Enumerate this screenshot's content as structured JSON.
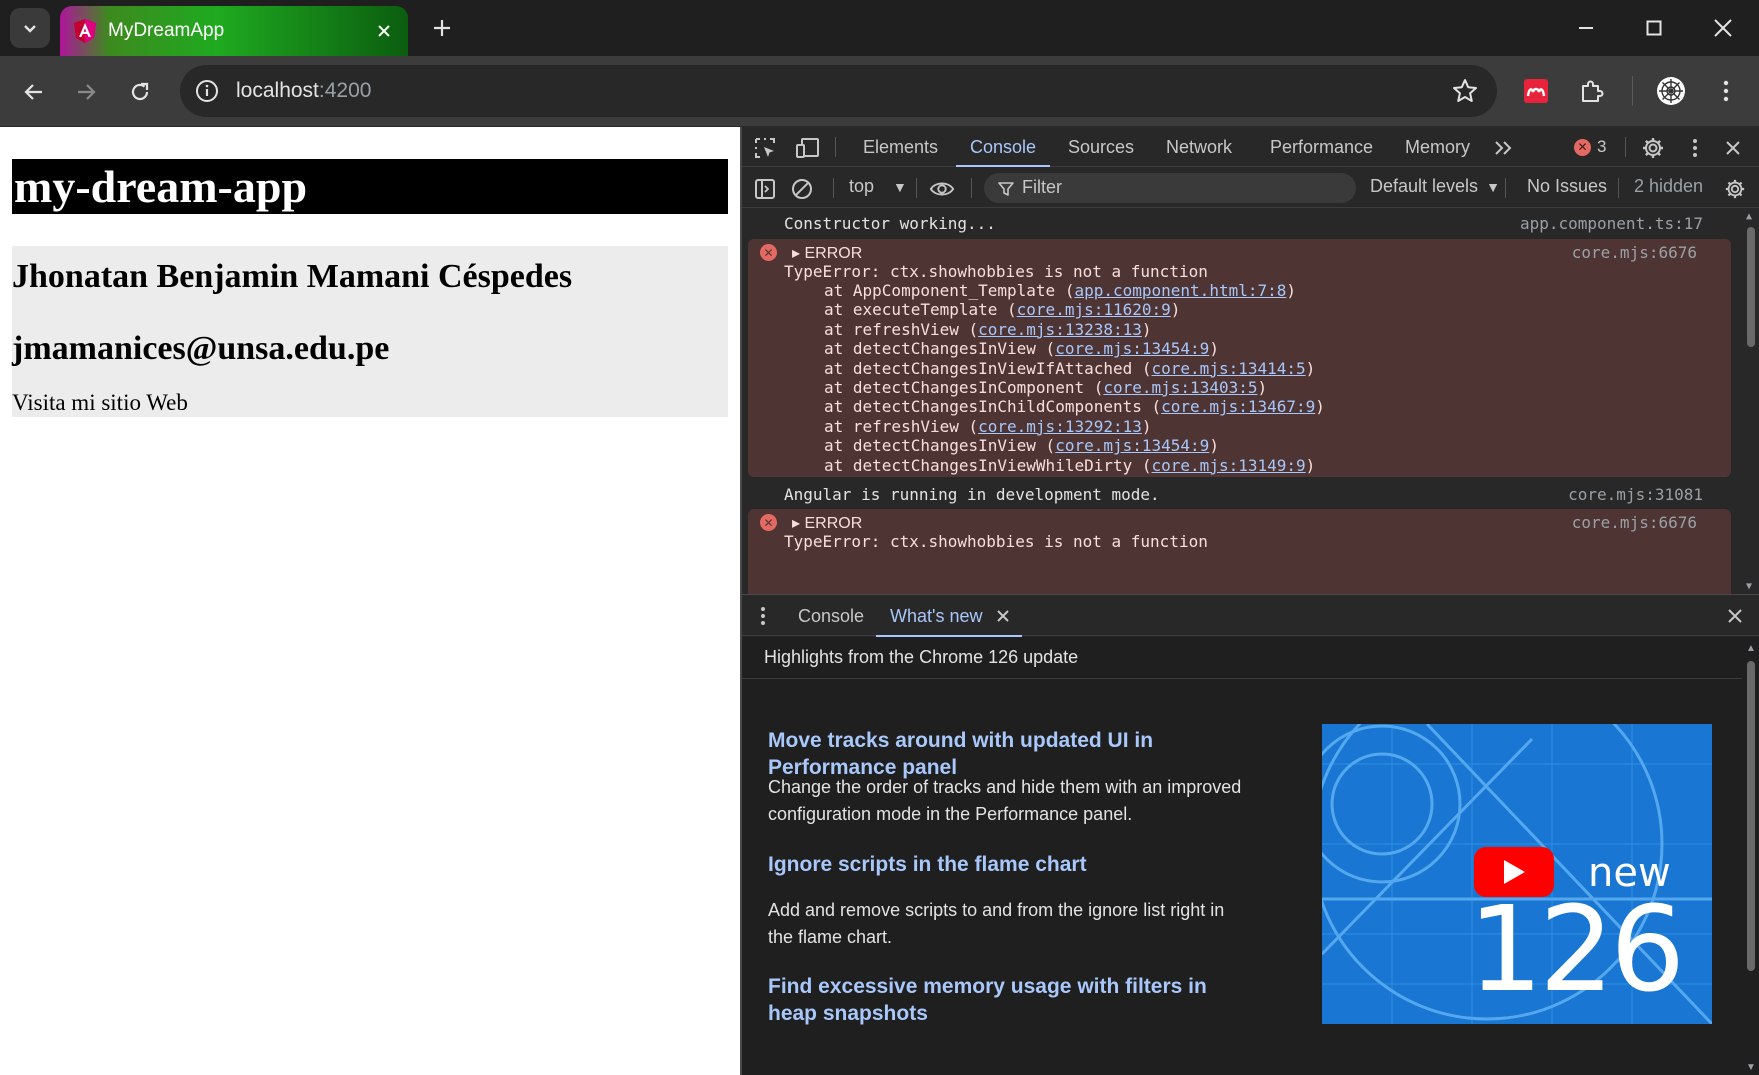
{
  "browser": {
    "tab_title": "MyDreamApp",
    "url_host": "localhost",
    "url_port": ":4200"
  },
  "page": {
    "title": "my-dream-app",
    "name": "Jhonatan Benjamin Mamani Céspedes",
    "email": "jmamanices@unsa.edu.pe",
    "link_text": "Visita mi sitio Web"
  },
  "devtools": {
    "tabs": [
      "Elements",
      "Console",
      "Sources",
      "Network",
      "Performance",
      "Memory"
    ],
    "active_tab": "Console",
    "error_count": "3",
    "console_toolbar": {
      "context": "top",
      "filter_placeholder": "Filter",
      "levels": "Default levels",
      "issues": "No Issues",
      "hidden": "2 hidden"
    },
    "messages": [
      {
        "type": "log",
        "text": "Constructor working...",
        "source": "app.component.ts:17"
      },
      {
        "type": "error",
        "label": "ERROR",
        "text": "TypeError: ctx.showhobbies is not a function",
        "source": "core.mjs:6676",
        "stack": [
          {
            "fn": "at AppComponent_Template (",
            "link": "app.component.html:7:8",
            "end": ")"
          },
          {
            "fn": "at executeTemplate (",
            "link": "core.mjs:11620:9",
            "end": ")"
          },
          {
            "fn": "at refreshView (",
            "link": "core.mjs:13238:13",
            "end": ")"
          },
          {
            "fn": "at detectChangesInView (",
            "link": "core.mjs:13454:9",
            "end": ")"
          },
          {
            "fn": "at detectChangesInViewIfAttached (",
            "link": "core.mjs:13414:5",
            "end": ")"
          },
          {
            "fn": "at detectChangesInComponent (",
            "link": "core.mjs:13403:5",
            "end": ")"
          },
          {
            "fn": "at detectChangesInChildComponents (",
            "link": "core.mjs:13467:9",
            "end": ")"
          },
          {
            "fn": "at refreshView (",
            "link": "core.mjs:13292:13",
            "end": ")"
          },
          {
            "fn": "at detectChangesInView (",
            "link": "core.mjs:13454:9",
            "end": ")"
          },
          {
            "fn": "at detectChangesInViewWhileDirty (",
            "link": "core.mjs:13149:9",
            "end": ")"
          }
        ]
      },
      {
        "type": "log",
        "text": "Angular is running in development mode.",
        "source": "core.mjs:31081"
      },
      {
        "type": "error",
        "label": "ERROR",
        "text": "TypeError: ctx.showhobbies is not a function",
        "source": "core.mjs:6676"
      }
    ],
    "drawer": {
      "tabs": [
        "Console",
        "What's new"
      ],
      "active_tab": "What's new",
      "whats_new": {
        "heading": "Highlights from the Chrome 126 update",
        "features": [
          {
            "title": "Move tracks around with updated UI in Performance panel",
            "desc": "Change the order of tracks and hide them with an improved configuration mode in the Performance panel."
          },
          {
            "title": "Ignore scripts in the flame chart",
            "desc": "Add and remove scripts to and from the ignore list right in the flame chart."
          },
          {
            "title": "Find excessive memory usage with filters in heap snapshots",
            "desc": ""
          }
        ],
        "banner_new": "new",
        "banner_version": "126"
      }
    }
  },
  "colors": {
    "accent": "#a8c7fa",
    "error_bg": "#4e3534",
    "error_icon": "#e46962",
    "banner_blue": "#1976d2",
    "youtube_red": "#ff0000"
  }
}
